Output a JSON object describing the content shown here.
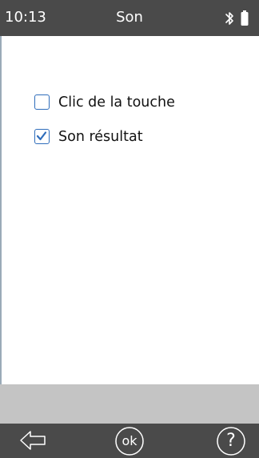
{
  "status_bar": {
    "time": "10:13",
    "title": "Son",
    "icons": [
      "bluetooth-icon",
      "battery-icon"
    ]
  },
  "options": [
    {
      "label": "Clic de la touche",
      "checked": false
    },
    {
      "label": "Son résultat",
      "checked": true
    }
  ],
  "nav": {
    "back_icon": "back-arrow-icon",
    "ok_label": "ok",
    "help_label": "?"
  },
  "colors": {
    "bar_background": "#4a4a4a",
    "message_bar": "#c4c4c4",
    "checkbox_accent": "#2f6dbb"
  }
}
